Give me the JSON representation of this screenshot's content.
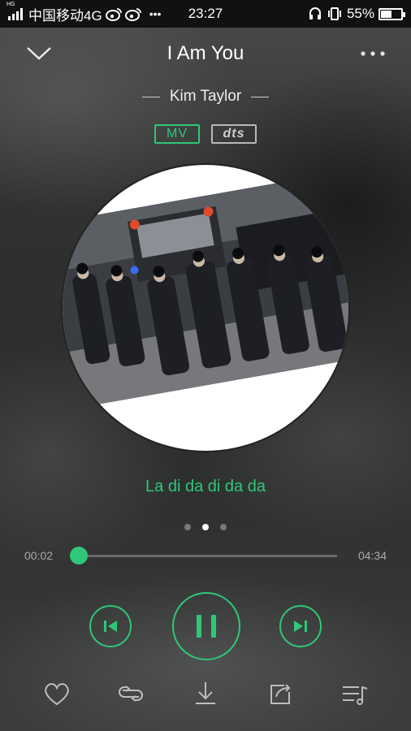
{
  "status_bar": {
    "network_badge": "HG",
    "carrier": "中国移动4G",
    "app_icons": [
      "weibo-icon",
      "weibo-icon"
    ],
    "more": "•••",
    "time": "23:27",
    "battery_percent": "55%",
    "battery_level": 0.55
  },
  "header": {
    "title": "I Am You"
  },
  "artist": "Kim Taylor",
  "badges": {
    "mv": "MV",
    "dts": "dts"
  },
  "lyric": "La di da di da da",
  "pager": {
    "count": 3,
    "active_index": 1
  },
  "progress": {
    "current": "00:02",
    "total": "04:34",
    "fraction": 0.007
  },
  "controls": {
    "previous": "previous-track-icon",
    "play_state": "pause-icon",
    "next": "next-track-icon"
  },
  "bottom_bar": {
    "items": [
      "heart-icon",
      "repeat-icon",
      "download-icon",
      "share-icon",
      "playlist-icon"
    ]
  },
  "colors": {
    "accent": "#2fc779",
    "dts_badge": "#b8b8b8"
  }
}
